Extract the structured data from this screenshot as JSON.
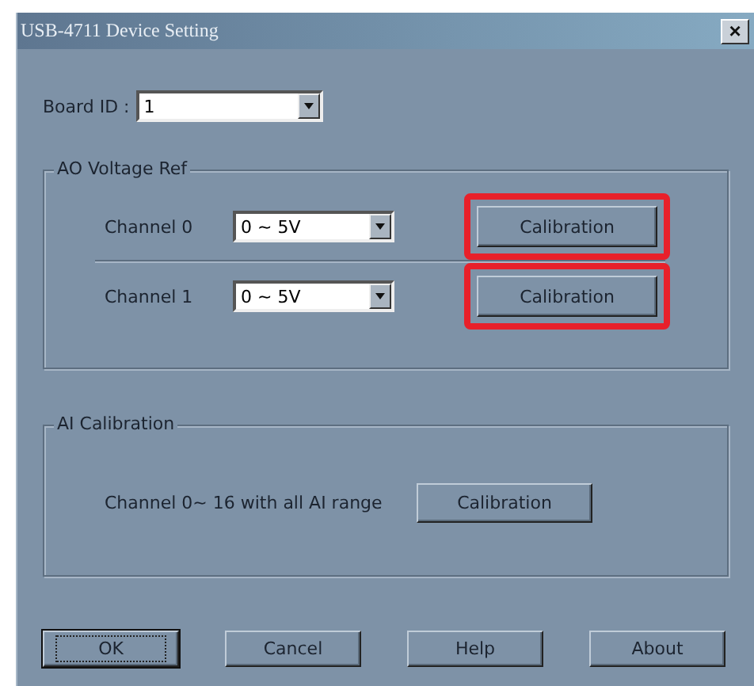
{
  "window": {
    "title": "USB-4711 Device Setting",
    "close": "×"
  },
  "board_id": {
    "label": "Board ID :",
    "value": "1"
  },
  "ao_group": {
    "title": "AO Voltage Ref",
    "channels": [
      {
        "label": "Channel 0",
        "range": "0 ~ 5V",
        "button": "Calibration",
        "highlighted": true
      },
      {
        "label": "Channel 1",
        "range": "0 ~ 5V",
        "button": "Calibration",
        "highlighted": true
      }
    ]
  },
  "ai_group": {
    "title": "AI Calibration",
    "text": "Channel 0~ 16 with all AI range",
    "button": "Calibration"
  },
  "buttons": [
    {
      "label": "OK",
      "default": true
    },
    {
      "label": "Cancel",
      "default": false
    },
    {
      "label": "Help",
      "default": false
    },
    {
      "label": "About",
      "default": false
    }
  ]
}
